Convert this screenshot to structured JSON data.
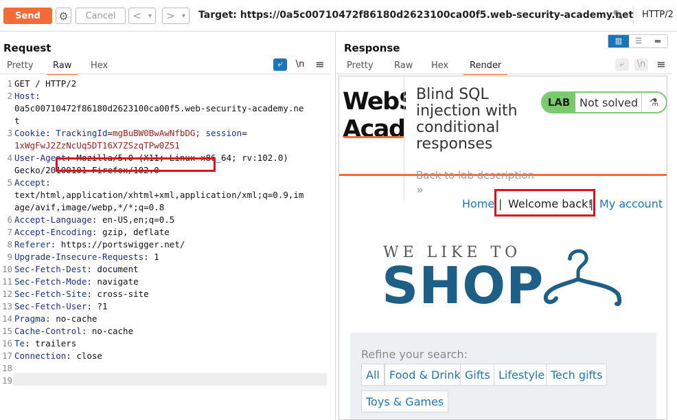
{
  "toolbar": {
    "send_label": "Send",
    "cancel_label": "Cancel",
    "back_label": "<",
    "forward_label": ">",
    "dropdown_arrow": "▾",
    "target": "Target: https://0a5c00710472f86180d2623100ca00f5.web-security-academy.net",
    "protocol": "HTTP/2"
  },
  "request": {
    "title": "Request",
    "tabs": [
      "Pretty",
      "Raw",
      "Hex"
    ],
    "active_tab": "Raw",
    "newline_label": "\\n",
    "lines": [
      {
        "n": "1",
        "text": "GET / HTTP/2"
      },
      {
        "n": "2",
        "name": "Host",
        "value": ""
      },
      {
        "n": "",
        "text": "0a5c00710472f86180d2623100ca00f5.web-security-academy.ne"
      },
      {
        "n": "",
        "text": "t"
      },
      {
        "n": "3",
        "name": "Cookie",
        "value": ""
      },
      {
        "n": "",
        "text": ""
      },
      {
        "n": "4",
        "name": "User-Agent",
        "value": "Mozilla/5.0 (X11; Linux x86_64; rv:102.0)"
      },
      {
        "n": "",
        "text": "Gecko/20100101 Firefox/102.0"
      },
      {
        "n": "5",
        "name": "Accept",
        "value": ""
      },
      {
        "n": "",
        "text": "text/html,application/xhtml+xml,application/xml;q=0.9,im"
      },
      {
        "n": "",
        "text": "age/avif,image/webp,*/*;q=0.8"
      },
      {
        "n": "6",
        "name": "Accept-Language",
        "value": "en-US,en;q=0.5"
      },
      {
        "n": "7",
        "name": "Accept-Encoding",
        "value": "gzip, deflate"
      },
      {
        "n": "8",
        "name": "Referer",
        "value": "https://portswigger.net/"
      },
      {
        "n": "9",
        "name": "Upgrade-Insecure-Requests",
        "value": "1"
      },
      {
        "n": "10",
        "name": "Sec-Fetch-Dest",
        "value": "document"
      },
      {
        "n": "11",
        "name": "Sec-Fetch-Mode",
        "value": "navigate"
      },
      {
        "n": "12",
        "name": "Sec-Fetch-Site",
        "value": "cross-site"
      },
      {
        "n": "13",
        "name": "Sec-Fetch-User",
        "value": "?1"
      },
      {
        "n": "14",
        "name": "Pragma",
        "value": "no-cache"
      },
      {
        "n": "15",
        "name": "Cache-Control",
        "value": "no-cache"
      },
      {
        "n": "16",
        "name": "Te",
        "value": "trailers"
      },
      {
        "n": "17",
        "name": "Connection",
        "value": "close"
      },
      {
        "n": "18",
        "text": ""
      },
      {
        "n": "19",
        "text": ""
      }
    ],
    "cookie": {
      "tracking_name": "TrackingId",
      "tracking_value": "mgBuBW0BwAwNfbDG;",
      "session_name": "session",
      "session_value": "1xWgFwJ2ZzNcUq5DT16X7ZSzqTPw0Z51"
    }
  },
  "response": {
    "title": "Response",
    "tabs": [
      "Pretty",
      "Raw",
      "Hex",
      "Render"
    ],
    "active_tab": "Render",
    "newline_label": "\\n",
    "render": {
      "logo_text_1": "WebS",
      "logo_text_2": "Acade",
      "lab_title": "Blind SQL injection with conditional responses",
      "lab_badge": "LAB",
      "lab_status": "Not solved",
      "back_link": "Back to lab description",
      "back_chevron": "»",
      "nav_home": "Home",
      "nav_pipe": "|",
      "nav_welcome": "Welcome back!",
      "nav_account": "My account",
      "shop_small": "WE LIKE TO",
      "shop_big": "SHOP",
      "refine_label": "Refine your search:",
      "categories": [
        "All",
        "Food & Drink",
        "Gifts",
        "Lifestyle",
        "Tech gifts",
        "Toys & Games"
      ]
    }
  },
  "colors": {
    "accent": "#f36b35",
    "highlight_box": "#e0101a",
    "link": "#1e74b8",
    "lab_green": "#7bc96f",
    "shop_blue": "#1e5f87"
  }
}
